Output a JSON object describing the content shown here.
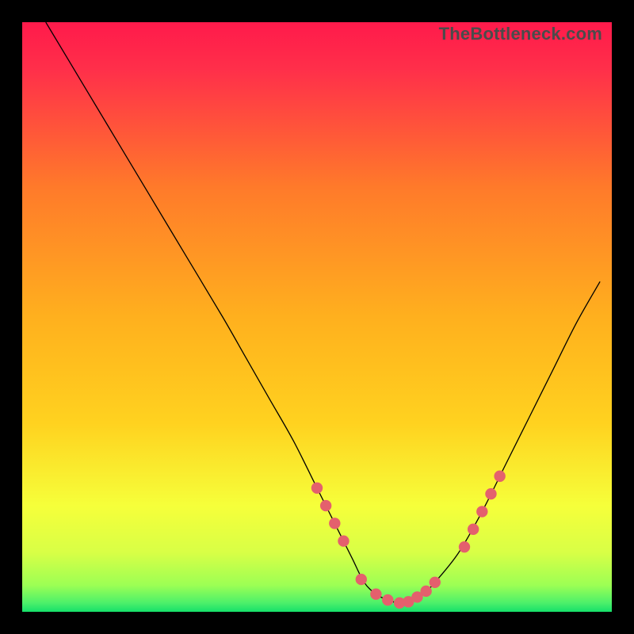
{
  "watermark": "TheBottleneck.com",
  "colors": {
    "bg_black": "#000000",
    "dot": "#e4606d",
    "curve": "#000000",
    "grad_top": "#ff1a4b",
    "grad_mid1": "#ff7a2a",
    "grad_mid2": "#ffd21f",
    "grad_mid3": "#f6ff3a",
    "grad_bottom": "#16e06a"
  },
  "chart_data": {
    "type": "line",
    "title": "",
    "xlabel": "",
    "ylabel": "",
    "xlim": [
      0,
      100
    ],
    "ylim": [
      0,
      100
    ],
    "curve": {
      "name": "bottleneck",
      "x": [
        4,
        10,
        16,
        22,
        28,
        34,
        38,
        42,
        46,
        50,
        52,
        54,
        56,
        58,
        60,
        62,
        64,
        66,
        68,
        70,
        74,
        78,
        82,
        86,
        90,
        94,
        98
      ],
      "y": [
        100,
        90,
        80,
        70,
        60,
        50,
        43,
        36,
        29,
        21,
        17,
        13,
        9,
        5,
        3,
        2,
        1.5,
        2,
        3,
        5,
        10,
        17,
        25,
        33,
        41,
        49,
        56
      ]
    },
    "dots": {
      "name": "highlight-points",
      "x": [
        50,
        51.5,
        53,
        54.5,
        57.5,
        60,
        62,
        64,
        65.5,
        67,
        68.5,
        70,
        75,
        76.5,
        78,
        79.5,
        81
      ],
      "y": [
        21,
        18,
        15,
        12,
        5.5,
        3,
        2,
        1.5,
        1.7,
        2.5,
        3.5,
        5,
        11,
        14,
        17,
        20,
        23
      ]
    }
  }
}
